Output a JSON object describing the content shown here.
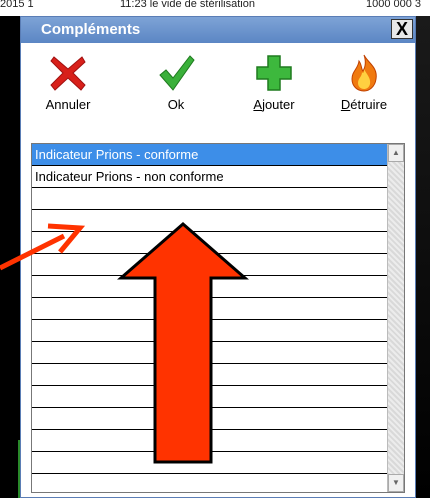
{
  "background": {
    "top_text_left": "2015 1",
    "top_text_mid": "11:23 le vide de stérilisation",
    "top_text_right": "1000 000 3"
  },
  "dialog": {
    "title": "Compléments",
    "close_label": "X"
  },
  "toolbar": {
    "cancel_label": "Annuler",
    "ok_label": "Ok",
    "add_label_prefix": "",
    "add_label_underlined": "A",
    "add_label_rest": "jouter",
    "destroy_label_underlined": "D",
    "destroy_label_rest": "étruire"
  },
  "list": {
    "items": [
      "Indicateur Prions - conforme",
      "Indicateur Prions - non conforme",
      "",
      "",
      "",
      "",
      "",
      "",
      "",
      "",
      "",
      "",
      "",
      "",
      "",
      ""
    ],
    "selected_index": 0,
    "scroll_up": "▲",
    "scroll_down": "▼"
  },
  "colors": {
    "annotation": "#ff3300",
    "selection": "#3d8ee8",
    "title_bar": "#5b86c4"
  }
}
